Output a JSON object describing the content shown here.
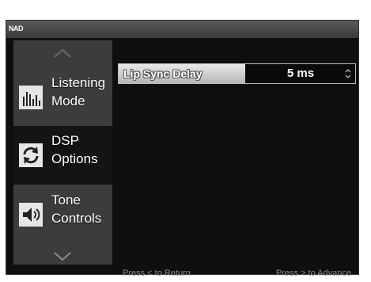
{
  "app": {
    "logo": "NAD"
  },
  "sidebar": {
    "items": [
      {
        "label_line1": "Listening",
        "label_line2": "Mode",
        "icon": "equalizer-bars-icon",
        "selected": false
      },
      {
        "label_line1": "DSP",
        "label_line2": "Options",
        "icon": "refresh-cycle-icon",
        "selected": true
      },
      {
        "label_line1": "Tone",
        "label_line2": "Controls",
        "icon": "speaker-icon",
        "selected": false
      }
    ]
  },
  "setting": {
    "label": "Lip Sync Delay",
    "value": "5 ms"
  },
  "footer": {
    "left": "Press < to Return",
    "right": "Press > to Advance"
  },
  "colors": {
    "background": "#0f0f0f",
    "sidebar": "#3c3c3c",
    "selected": "#141414",
    "text": "#ffffff",
    "hint": "#8a8a8a"
  }
}
